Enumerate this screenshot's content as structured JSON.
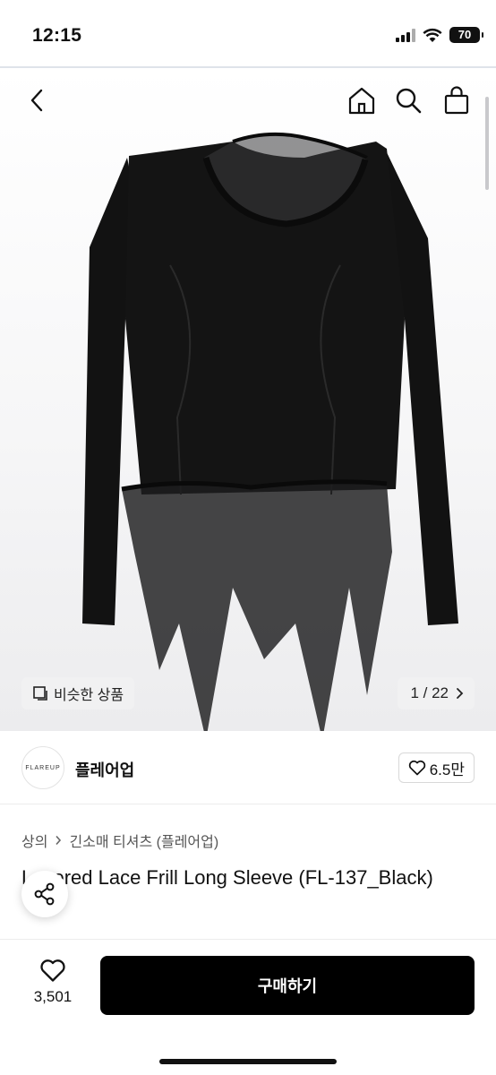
{
  "status_bar": {
    "time": "12:15",
    "battery": "70"
  },
  "nav": {
    "back_icon": "chevron-left-icon",
    "home_icon": "home-icon",
    "search_icon": "search-icon",
    "cart_icon": "shopping-bag-icon"
  },
  "hero": {
    "similar_label": "비슷한 상품",
    "pager": "1 / 22",
    "image_position": {
      "current": 1,
      "total": 22
    }
  },
  "shop": {
    "logo_text": "FLAREUP",
    "name": "플레어업",
    "likes": "6.5만"
  },
  "product": {
    "breadcrumb": [
      "상의",
      "긴소매 티셔츠 (플레어업)"
    ],
    "title": "Layered Lace Frill Long Sleeve (FL-137_Black)"
  },
  "bottom": {
    "wish_count": "3,501",
    "buy_label": "구매하기"
  },
  "colors": {
    "accent": "#000000",
    "chip_bg": "#f1f1f2"
  }
}
